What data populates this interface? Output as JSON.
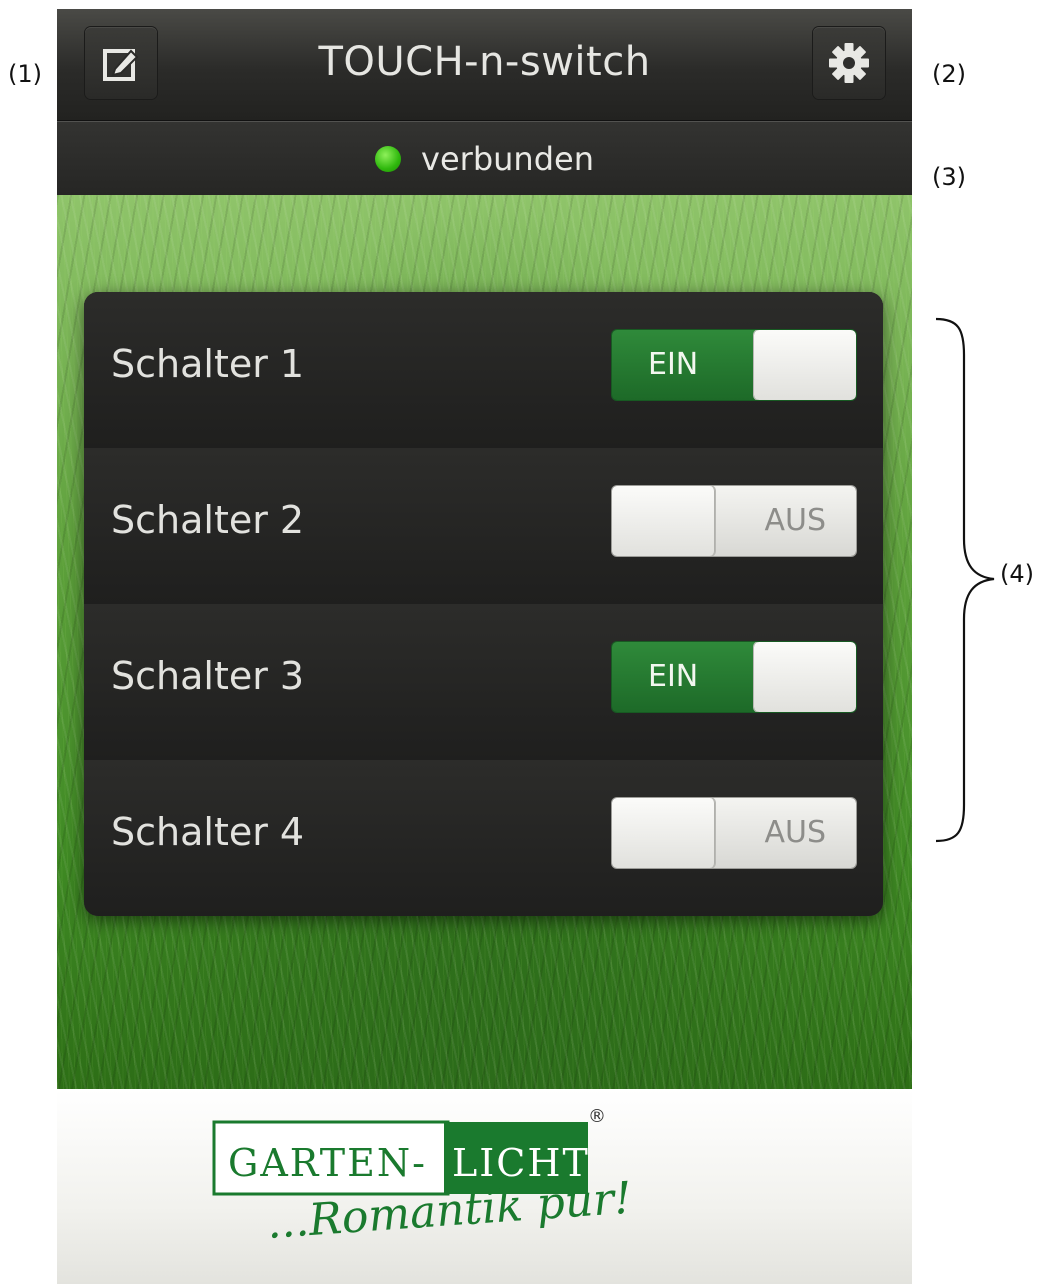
{
  "callouts": {
    "c1": "(1)",
    "c2": "(2)",
    "c3": "(3)",
    "c4": "(4)"
  },
  "header": {
    "title": "TOUCH-n-switch",
    "edit_icon": "edit-icon",
    "settings_icon": "gear-icon"
  },
  "status": {
    "text": "verbunden",
    "color": "#3dd017"
  },
  "switches": [
    {
      "label": "Schalter 1",
      "state": "EIN",
      "on": true
    },
    {
      "label": "Schalter 2",
      "state": "AUS",
      "on": false
    },
    {
      "label": "Schalter 3",
      "state": "EIN",
      "on": true
    },
    {
      "label": "Schalter 4",
      "state": "AUS",
      "on": false
    }
  ],
  "footer": {
    "logo_left": "GARTEN-",
    "logo_right": "LICHT",
    "logo_mark": "®",
    "tagline": "...Romantik pur!"
  },
  "colors": {
    "accent_green": "#1d6a28",
    "logo_green": "#1a7a2e"
  }
}
